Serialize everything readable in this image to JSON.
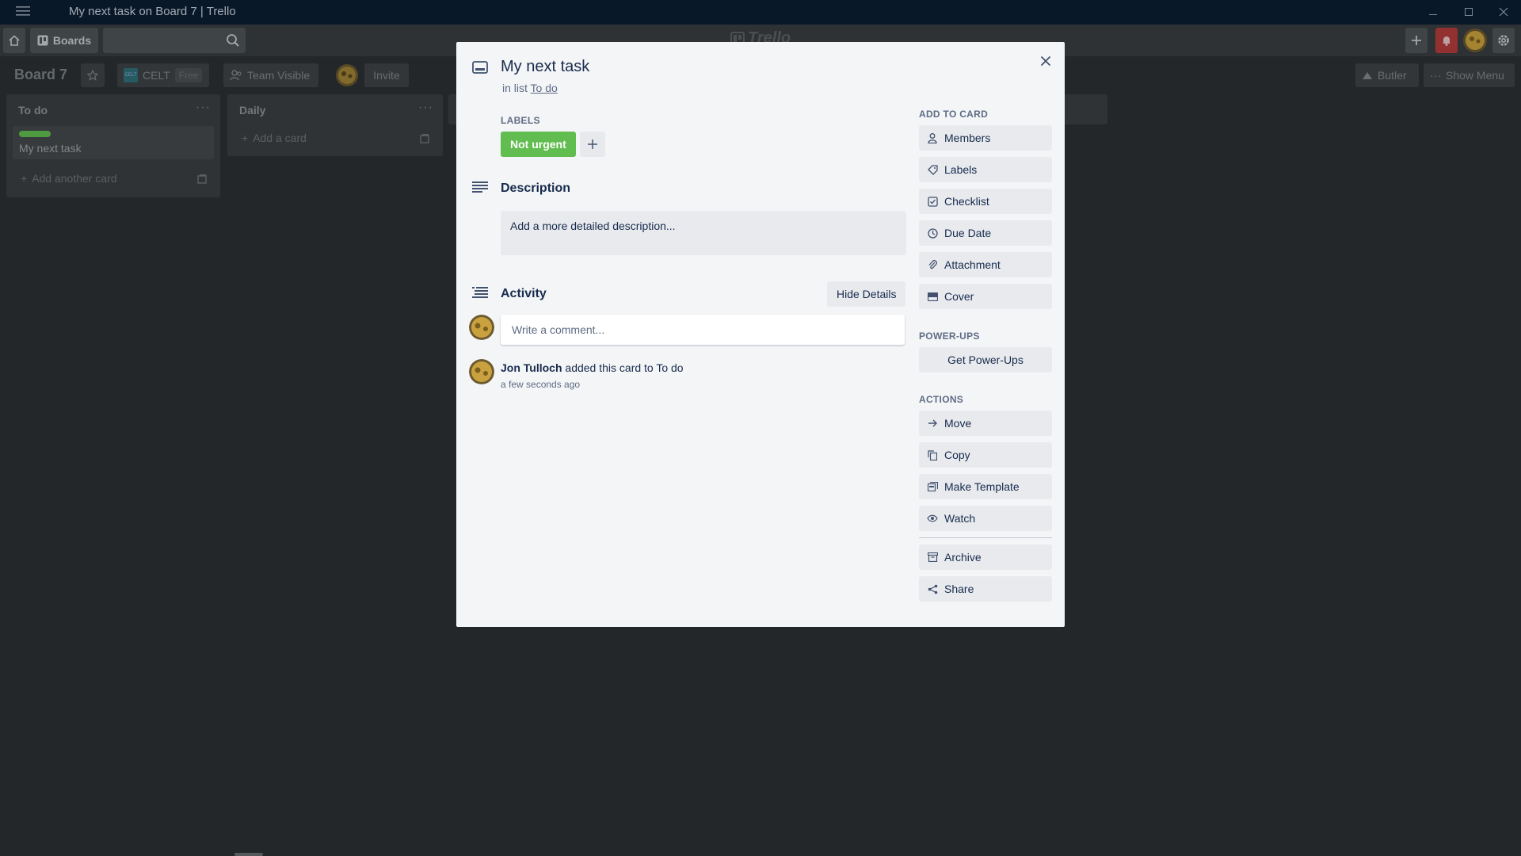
{
  "window": {
    "title": "My next task on Board 7 | Trello"
  },
  "header": {
    "boards_label": "Boards",
    "logo_text": "Trello"
  },
  "board": {
    "title": "Board 7",
    "team": {
      "logo": "CELT",
      "name": "CELT",
      "badge": "Free"
    },
    "visibility": "Team Visible",
    "invite": "Invite",
    "butler": "Butler",
    "show_menu": "Show Menu"
  },
  "lists": [
    {
      "title": "To do",
      "cards": [
        {
          "title": "My next task",
          "label_color": "#61bd4f"
        }
      ],
      "add_label": "Add another card"
    },
    {
      "title": "Daily",
      "cards": [],
      "add_label": "Add a card"
    }
  ],
  "modal": {
    "title": "My next task",
    "in_list_prefix": "in list",
    "list_name": "To do",
    "labels_heading": "LABELS",
    "label": {
      "text": "Not urgent",
      "color": "#61bd4f"
    },
    "description_title": "Description",
    "description_placeholder": "Add a more detailed description...",
    "activity_title": "Activity",
    "hide_details": "Hide Details",
    "comment_placeholder": "Write a comment...",
    "activity": {
      "user": "Jon Tulloch",
      "action": " added this card to To do",
      "time": "a few seconds ago"
    },
    "add_to_card_heading": "ADD TO CARD",
    "add_to_card": [
      {
        "label": "Members",
        "icon": "person-icon"
      },
      {
        "label": "Labels",
        "icon": "tag-icon"
      },
      {
        "label": "Checklist",
        "icon": "checklist-icon"
      },
      {
        "label": "Due Date",
        "icon": "clock-icon"
      },
      {
        "label": "Attachment",
        "icon": "paperclip-icon"
      },
      {
        "label": "Cover",
        "icon": "cover-icon"
      }
    ],
    "powerups_heading": "POWER-UPS",
    "get_powerups": "Get Power-Ups",
    "actions_heading": "ACTIONS",
    "actions": [
      {
        "label": "Move",
        "icon": "arrow-right-icon"
      },
      {
        "label": "Copy",
        "icon": "copy-icon"
      },
      {
        "label": "Make Template",
        "icon": "template-icon"
      },
      {
        "label": "Watch",
        "icon": "eye-icon"
      },
      {
        "label": "Archive",
        "icon": "archive-icon"
      },
      {
        "label": "Share",
        "icon": "share-icon"
      }
    ]
  }
}
